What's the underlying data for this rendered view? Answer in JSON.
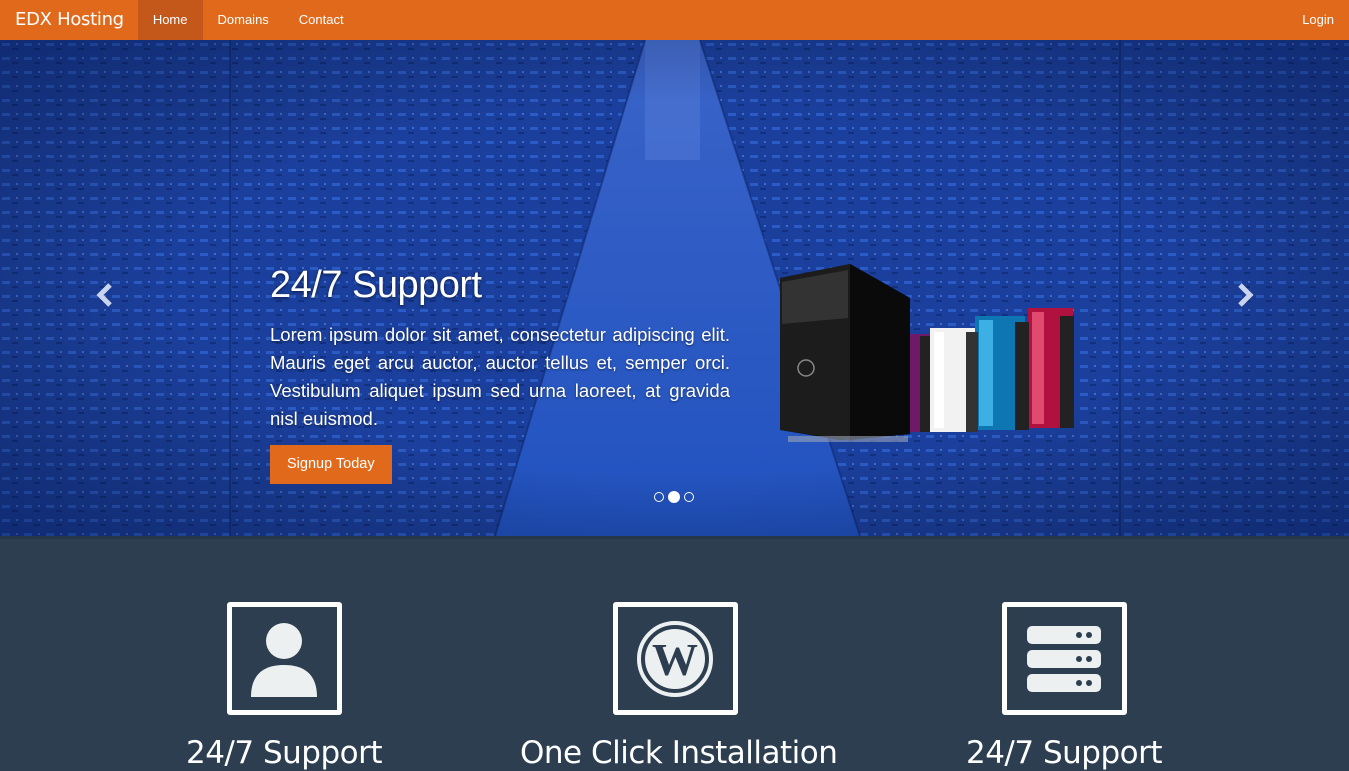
{
  "navbar": {
    "brand": "EDX Hosting",
    "items": [
      {
        "label": "Home",
        "active": true
      },
      {
        "label": "Domains",
        "active": false
      },
      {
        "label": "Contact",
        "active": false
      }
    ],
    "login_label": "Login",
    "accent_color": "#e1691c"
  },
  "hero": {
    "title": "24/7 Support",
    "text": "Lorem ipsum dolor sit amet, consectetur adipiscing elit. Mauris eget arcu auctor, auctor tellus et, semper orci. Vestibulum aliquet ipsum sed urna laoreet, at gravida nisl euismod.",
    "button_label": "Signup Today",
    "prev_icon": "chevron-left-icon",
    "next_icon": "chevron-right-icon",
    "slide_count": 3,
    "active_slide": 2
  },
  "features": [
    {
      "icon": "user-icon",
      "title": "24/7 Support"
    },
    {
      "icon": "wordpress-icon",
      "title": "One Click Installation"
    },
    {
      "icon": "server-icon",
      "title": "24/7 Support"
    }
  ]
}
